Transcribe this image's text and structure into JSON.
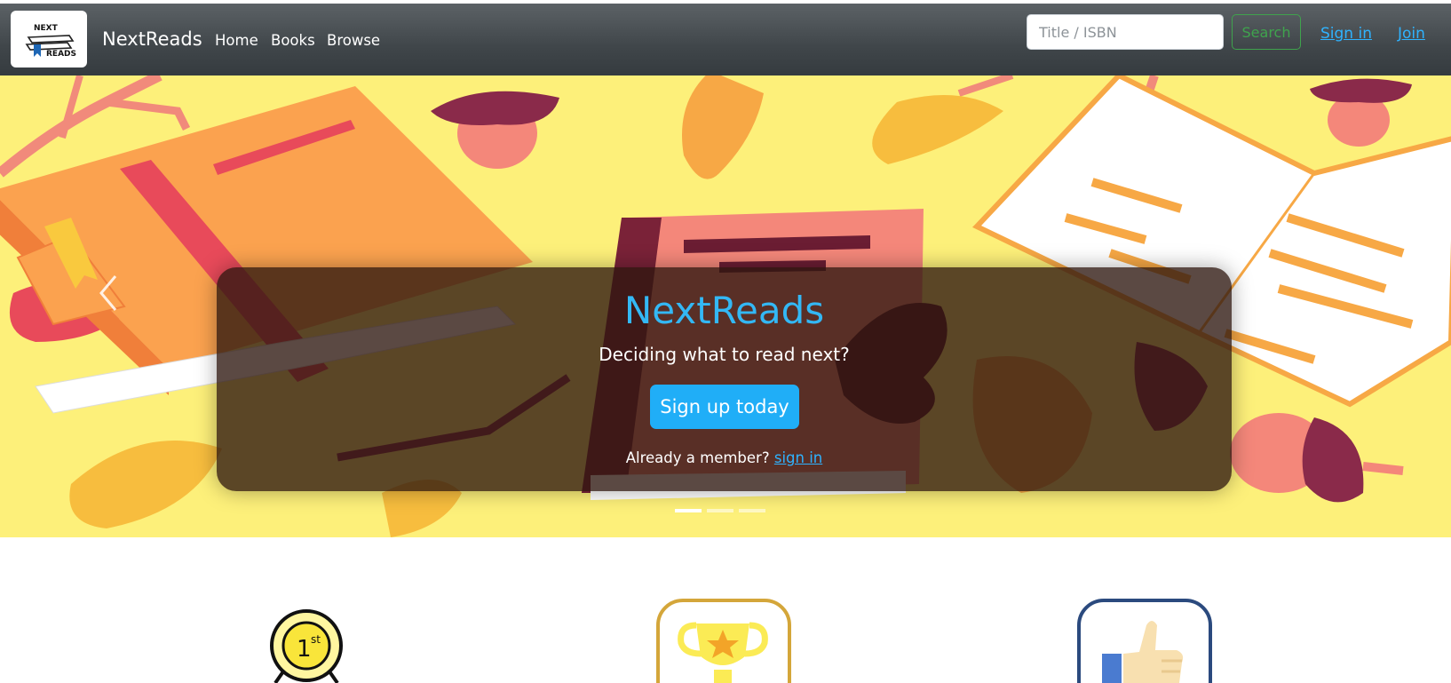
{
  "navbar": {
    "logo_text_top": "NEXT",
    "logo_text_bottom": "READS",
    "brand": "NextReads",
    "links": [
      {
        "label": "Home"
      },
      {
        "label": "Books"
      },
      {
        "label": "Browse"
      }
    ],
    "search": {
      "placeholder": "Title / ISBN",
      "value": ""
    },
    "search_button": "Search",
    "sign_in": "Sign in",
    "join": "Join"
  },
  "hero": {
    "title": "NextReads",
    "subtitle": "Deciding what to read next?",
    "cta": "Sign up today",
    "member_prefix": "Already a member?",
    "member_link": "sign in",
    "slides": 3,
    "active_slide": 1
  },
  "features": {
    "icons": [
      "first-place-medal-icon",
      "trophy-icon",
      "thumbs-up-icon"
    ],
    "medal_text": "1",
    "medal_suffix": "st"
  },
  "colors": {
    "navbar": "#40464a",
    "accent_blue": "#20aef7",
    "search_green": "#3fa34d",
    "hero_bg": "#fdf07a"
  }
}
